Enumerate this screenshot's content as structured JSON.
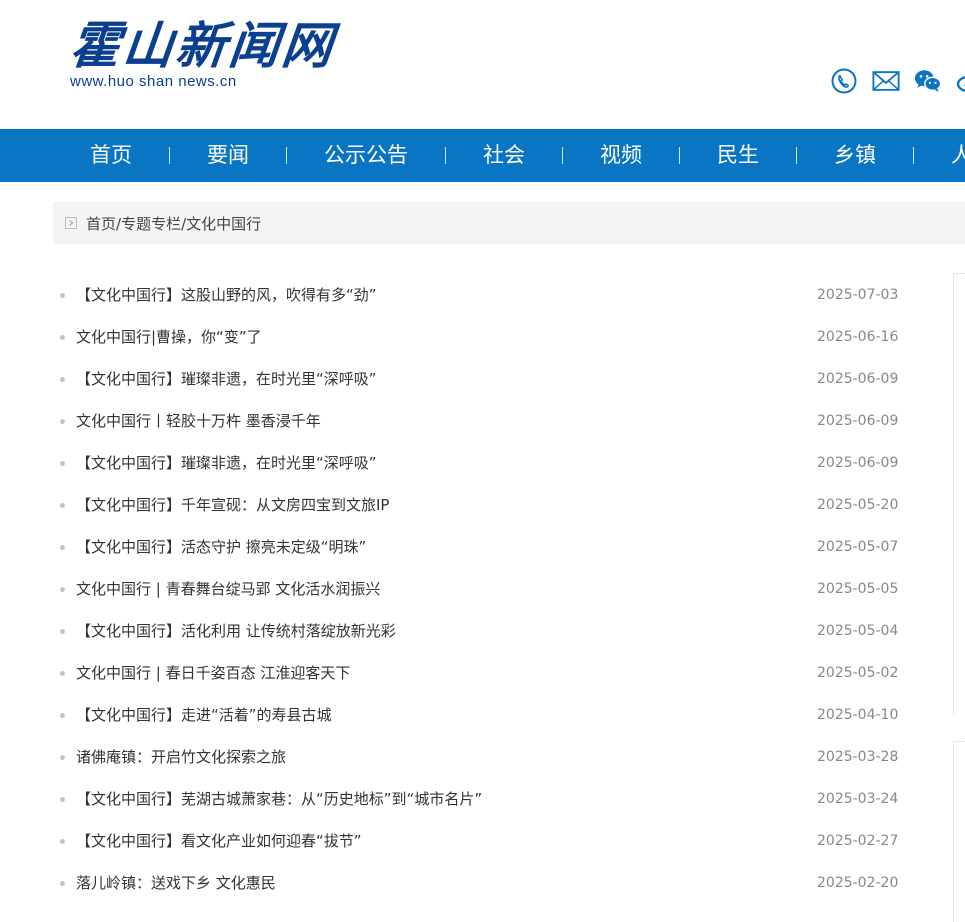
{
  "header": {
    "logo_cn": "霍山新闻网",
    "logo_en": "www.huo shan news.cn",
    "icons": [
      "phone-icon",
      "mail-icon",
      "wechat-icon",
      "weibo-icon"
    ]
  },
  "nav": {
    "items": [
      "首页",
      "要闻",
      "公示公告",
      "社会",
      "视频",
      "民生",
      "乡镇",
      "人"
    ]
  },
  "breadcrumb": {
    "home": "首页",
    "section": "专题专栏",
    "current": "文化中国行",
    "separator": "/"
  },
  "articles": [
    {
      "title": "【文化中国行】这股山野的风，吹得有多“劲”",
      "date": "2025-07-03"
    },
    {
      "title": "文化中国行|曹操，你“变”了",
      "date": "2025-06-16"
    },
    {
      "title": "【文化中国行】璀璨非遗，在时光里“深呼吸”",
      "date": "2025-06-09"
    },
    {
      "title": "文化中国行丨轻胶十万杵 墨香浸千年",
      "date": "2025-06-09"
    },
    {
      "title": "【文化中国行】璀璨非遗，在时光里“深呼吸”",
      "date": "2025-06-09"
    },
    {
      "title": "【文化中国行】千年宣砚：从文房四宝到文旅IP",
      "date": "2025-05-20"
    },
    {
      "title": "【文化中国行】活态守护 擦亮未定级“明珠”",
      "date": "2025-05-07"
    },
    {
      "title": "文化中国行 | 青春舞台绽马郢 文化活水润振兴",
      "date": "2025-05-05"
    },
    {
      "title": "【文化中国行】活化利用 让传统村落绽放新光彩",
      "date": "2025-05-04"
    },
    {
      "title": "文化中国行 | 春日千姿百态 江淮迎客天下",
      "date": "2025-05-02"
    },
    {
      "title": "【文化中国行】走进“活着”的寿县古城",
      "date": "2025-04-10"
    },
    {
      "title": "诸佛庵镇：开启竹文化探索之旅",
      "date": "2025-03-28"
    },
    {
      "title": "【文化中国行】芜湖古城萧家巷：从“历史地标”到“城市名片”",
      "date": "2025-03-24"
    },
    {
      "title": "【文化中国行】看文化产业如何迎春“拔节”",
      "date": "2025-02-27"
    },
    {
      "title": "落儿岭镇：送戏下乡 文化惠民",
      "date": "2025-02-20"
    }
  ],
  "colors": {
    "nav_bg": "#0a75c2",
    "logo": "#0b3f8f",
    "icon": "#0a75c2",
    "date": "#888888",
    "breadcrumb_bg": "#f5f5f5"
  }
}
